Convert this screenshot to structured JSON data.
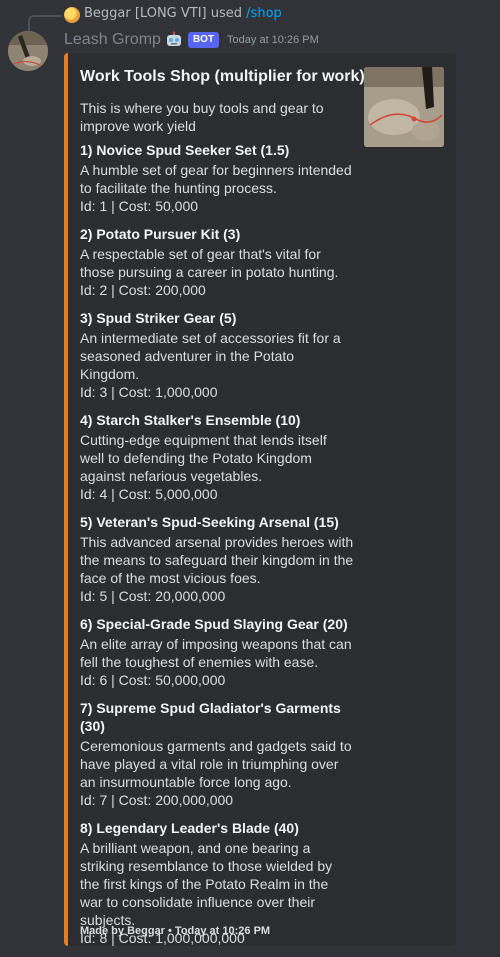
{
  "reply": {
    "user": "Beggar [LONG VTI]",
    "verb": "used",
    "command": "/shop"
  },
  "message": {
    "username": "Leash Gromp",
    "bot_tag": "BOT",
    "timestamp": "Today at 10:26 PM",
    "user_emoji": "robot-face-icon"
  },
  "embed": {
    "accent_color": "#e67e22",
    "title": "Work Tools Shop (multiplier for work)",
    "description": "This is where you buy tools and gear to improve work yield",
    "items": [
      {
        "name": "1) Novice Spud Seeker Set (1.5)",
        "description": "A humble set of gear for beginners intended to facilitate the hunting process.",
        "meta": "Id: 1 | Cost: 50,000"
      },
      {
        "name": "2) Potato Pursuer Kit (3)",
        "description": "A respectable set of gear that's vital for those pursuing a career in potato hunting.",
        "meta": "Id: 2 | Cost: 200,000"
      },
      {
        "name": "3) Spud Striker Gear (5)",
        "description": "An intermediate set of accessories fit for a seasoned adventurer in the Potato Kingdom.",
        "meta": "Id: 3 | Cost: 1,000,000"
      },
      {
        "name": "4) Starch Stalker's Ensemble (10)",
        "description": "Cutting-edge equipment that lends itself well to defending the Potato Kingdom against nefarious vegetables.",
        "meta": "Id: 4 | Cost: 5,000,000"
      },
      {
        "name": "5) Veteran's Spud-Seeking Arsenal (15)",
        "description": "This advanced arsenal provides heroes with the means to safeguard their kingdom in the face of the most vicious foes.",
        "meta": "Id: 5 | Cost: 20,000,000"
      },
      {
        "name": "6) Special-Grade Spud Slaying Gear (20)",
        "description": "An elite array of imposing weapons that can fell the toughest of enemies with ease.",
        "meta": "Id: 6 | Cost: 50,000,000"
      },
      {
        "name": "7) Supreme Spud Gladiator's Garments (30)",
        "description": "Ceremonious garments and gadgets said to have played a vital role in triumphing over an insurmountable force long ago.",
        "meta": "Id: 7 | Cost: 200,000,000"
      },
      {
        "name": "8) Legendary Leader's Blade (40)",
        "description": "A brilliant weapon, and one bearing a striking resemblance to those wielded by the first kings of the Potato Realm in the war to consolidate influence over their subjects.",
        "meta": "Id: 8 | Cost: 1,000,000,000"
      }
    ],
    "footer": "Made by Beggar • Today at 10:26 PM"
  }
}
